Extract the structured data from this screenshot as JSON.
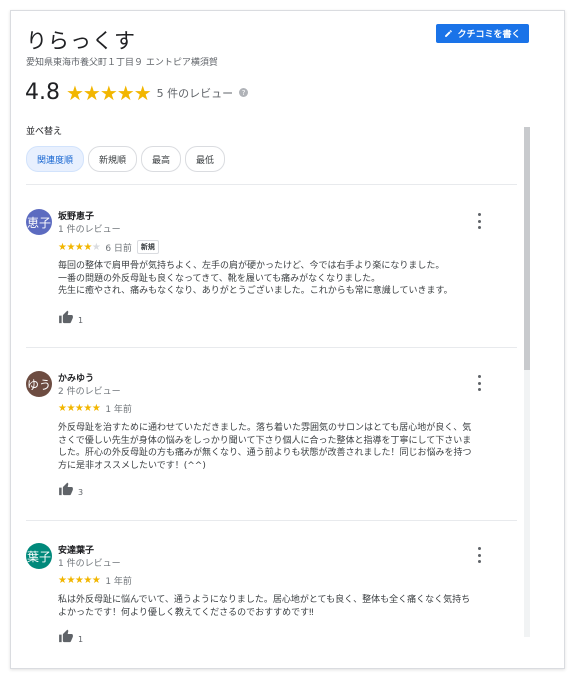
{
  "header": {
    "name": "りらっくす",
    "address": "愛知県東海市養父町１丁目９ エントピア横須賀",
    "write_review_label": "クチコミを書く",
    "rating": "4.8",
    "stars": "★★★★★",
    "review_count": "5 件のレビュー",
    "help_icon": "?"
  },
  "sort": {
    "label": "並べ替え",
    "options": [
      "関連度順",
      "新規順",
      "最高",
      "最低"
    ],
    "selected": "関連度順"
  },
  "colors": {
    "accent": "#1a73e8",
    "star": "#f2b600"
  },
  "reviews": [
    {
      "avatar_text": "恵子",
      "avatar_color": "#5c6bc0",
      "name": "坂野恵子",
      "review_count": "1 件のレビュー",
      "stars_on": "★★★★",
      "stars_off": "★",
      "rating": 4,
      "date": "6 日前",
      "badge": "新規",
      "lines": [
        "毎回の整体で肩甲骨が気持ちよく、左手の肩が硬かったけど、今では右手より楽になりました。",
        "一番の問題の外反母趾も良くなってきて、靴を履いても痛みがなくなりました。",
        "先生に癒やされ、痛みもなくなり、ありがとうございました。これからも常に意識していきます。"
      ],
      "likes": "1",
      "more_icon": "more-vertical-icon"
    },
    {
      "avatar_text": "ゆう",
      "avatar_color": "#6d4c41",
      "name": "かみゆう",
      "review_count": "2 件のレビュー",
      "stars_on": "★★★★★",
      "stars_off": "",
      "rating": 5,
      "date": "1 年前",
      "badge": "",
      "lines": [
        "外反母趾を治すために通わせていただきました。落ち着いた雰囲気のサロンはとても居心地が良く、気",
        "さくで優しい先生が身体の悩みをしっかり聞いて下さり個人に合った整体と指導を丁寧にして下さいま",
        "した。肝心の外反母趾の方も痛みが無くなり、通う前よりも状態が改善されました！同じお悩みを持つ",
        "方に是非オススメしたいです！(^^)"
      ],
      "likes": "3",
      "more_icon": "more-vertical-icon"
    },
    {
      "avatar_text": "葉子",
      "avatar_color": "#00897b",
      "name": "安達葉子",
      "review_count": "1 件のレビュー",
      "stars_on": "★★★★★",
      "stars_off": "",
      "rating": 5,
      "date": "1 年前",
      "badge": "",
      "lines": [
        "私は外反母趾に悩んでいて、通うようになりました。居心地がとても良く、整体も全く痛くなく気持ち",
        "よかったです！何より優しく教えてくださるのでおすすめです‼"
      ],
      "likes": "1",
      "more_icon": "more-vertical-icon"
    }
  ]
}
